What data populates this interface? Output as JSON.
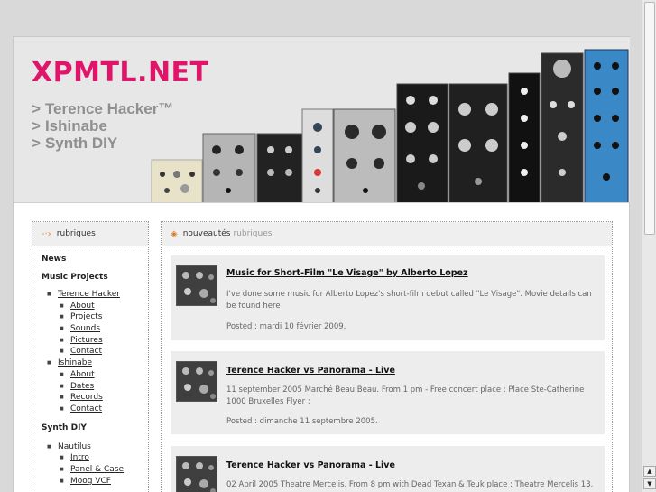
{
  "header": {
    "site_title": "XPMTL.NET",
    "taglines": [
      "Terence Hacker™",
      "Ishinabe",
      "Synth DIY"
    ],
    "tagline_prefix": ">"
  },
  "sidebar": {
    "title": "rubriques",
    "news_label": "News",
    "music_projects_label": "Music Projects",
    "music_projects": [
      {
        "label": "Terence Hacker",
        "children": [
          "About",
          "Projects",
          "Sounds",
          "Pictures",
          "Contact"
        ]
      },
      {
        "label": "Ishinabe",
        "children": [
          "About",
          "Dates",
          "Records",
          "Contact"
        ]
      }
    ],
    "synth_diy_label": "Synth DIY",
    "synth_diy": [
      {
        "label": "Nautilus",
        "children": [
          "Intro",
          "Panel & Case",
          "Moog VCF"
        ]
      }
    ]
  },
  "main": {
    "title_strong": "nouveautés",
    "title_muted": "rubriques",
    "posts": [
      {
        "title": "Music for Short-Film \"Le Visage\" by Alberto Lopez",
        "body": "I've done some music for Alberto Lopez's short-film debut called \"Le Visage\". Movie details can be found here",
        "date": "Posted : mardi 10 février 2009."
      },
      {
        "title": "Terence Hacker vs Panorama - Live",
        "body": "11 september 2005 Marché Beau Beau. From 1 pm - Free concert place : Place Ste-Catherine 1000 Bruxelles Flyer :",
        "date": "Posted : dimanche 11 septembre 2005."
      },
      {
        "title": "Terence Hacker vs Panorama - Live",
        "body": "02 April 2005 Theatre Mercelis. From 8 pm with Dead Texan & Teuk place : Theatre Mercelis 13.",
        "date": ""
      }
    ]
  },
  "colors": {
    "brand": "#e0156a",
    "accent_arrow": "#f08a1f",
    "tagline": "#8f8f8f"
  },
  "icons": {
    "section_arrow": "arrow-icon",
    "main_bullet": "diamond-icon"
  }
}
